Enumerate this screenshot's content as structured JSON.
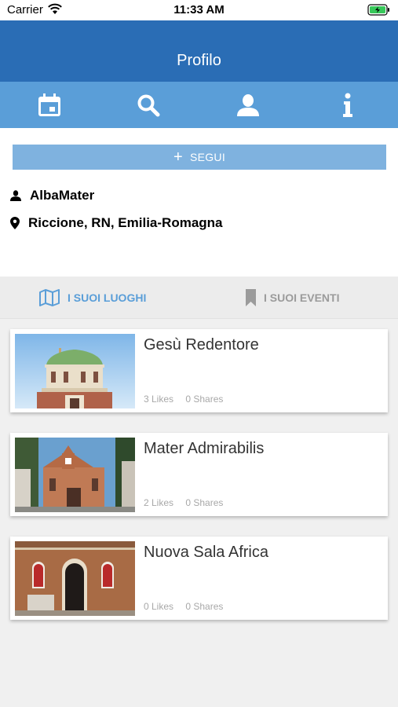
{
  "status": {
    "carrier": "Carrier",
    "time": "11:33 AM"
  },
  "nav": {
    "title": "Profilo"
  },
  "tabs": [
    {
      "icon": "calendar-icon"
    },
    {
      "icon": "search-icon"
    },
    {
      "icon": "user-icon"
    },
    {
      "icon": "info-icon"
    }
  ],
  "profile": {
    "follow_label": "SEGUI",
    "username": "AlbaMater",
    "location": "Riccione, RN, Emilia-Romagna"
  },
  "segments": {
    "places": "I SUOI LUOGHI",
    "events": "I SUOI EVENTI"
  },
  "colors": {
    "nav": "#2a6db5",
    "tabbar": "#5a9ed8",
    "follow": "#7fb2df",
    "active": "#5a9ed8"
  },
  "places": [
    {
      "name": "Gesù Redentore",
      "likes": "3 Likes",
      "shares": "0 Shares"
    },
    {
      "name": "Mater Admirabilis",
      "likes": "2 Likes",
      "shares": "0 Shares"
    },
    {
      "name": "Nuova Sala Africa",
      "likes": "0 Likes",
      "shares": "0 Shares"
    }
  ]
}
